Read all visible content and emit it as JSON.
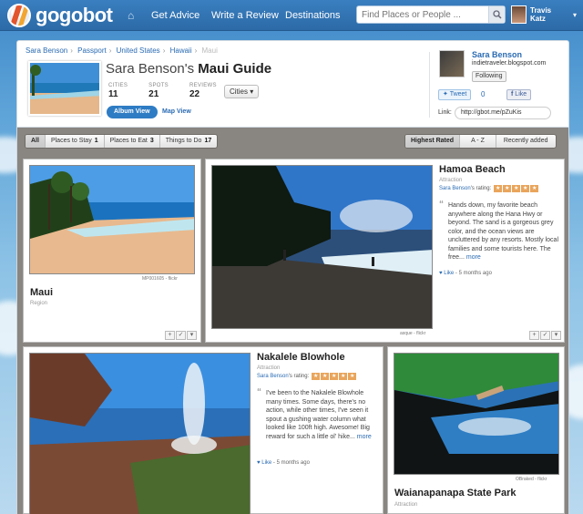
{
  "nav": {
    "logo": "gogobot",
    "links": [
      "Get Advice",
      "Write a Review",
      "Destinations"
    ],
    "search_placeholder": "Find Places or People ...",
    "user": [
      "Travis",
      "Katz"
    ]
  },
  "breadcrumb": {
    "items": [
      "Sara Benson",
      "Passport",
      "United States",
      "Hawaii",
      "Maui"
    ]
  },
  "guide": {
    "owner_first": "Sara Benson's",
    "title_bold": "Maui Guide",
    "stats": [
      {
        "label": "CITIES",
        "value": "11"
      },
      {
        "label": "SPOTS",
        "value": "21"
      },
      {
        "label": "REVIEWS",
        "value": "22"
      }
    ],
    "cities_dropdown": "Cities",
    "album_view": "Album View",
    "map_view": "Map View"
  },
  "owner": {
    "name": "Sara Benson",
    "site": "indietraveler.blogspot.com",
    "following": "Following",
    "tweet": "Tweet",
    "tweet_count": "0",
    "like": "Like",
    "link_label": "Link:",
    "link_url": "http://gbot.me/pZuKis"
  },
  "filters": {
    "all": "All",
    "stay": {
      "label": "Places to Stay",
      "count": "1"
    },
    "eat": {
      "label": "Places to Eat",
      "count": "3"
    },
    "todo": {
      "label": "Things to Do",
      "count": "17"
    },
    "sort": [
      "Highest Rated",
      "A - Z",
      "Recently added"
    ]
  },
  "cards": {
    "maui": {
      "title": "Maui",
      "type": "Region",
      "credit": "MP001605 - flickr"
    },
    "hamoa": {
      "title": "Hamoa Beach",
      "type": "Attraction",
      "rating_owner": "Sara Benson",
      "rating_suffix": "'s rating:",
      "review": "Hands down, my favorite beach anywhere along the Hana Hwy or beyond. The sand is a gorgeous grey color, and the ocean views are uncluttered by any resorts. Mostly local families and some tourists here. The free...",
      "more": "more",
      "like": "Like",
      "age": "- 5 months ago",
      "credit": "asque - flickr",
      "stars": 5
    },
    "nakalele": {
      "title": "Nakalele Blowhole",
      "type": "Attraction",
      "rating_owner": "Sara Benson",
      "rating_suffix": "'s rating:",
      "review": "I've been to the Nakalele Blowhole many times. Some days, there's no action, while other times, I've seen it spout a gushing water column what looked like 100ft high. Awesome! Big reward for such a little ol' hike...",
      "more": "more",
      "like": "Like",
      "age": "- 5 months ago",
      "stars": 5
    },
    "waianapanapa": {
      "title": "Waianapanapa State Park",
      "type": "Attraction",
      "credit": "OBraked - flickr"
    }
  }
}
